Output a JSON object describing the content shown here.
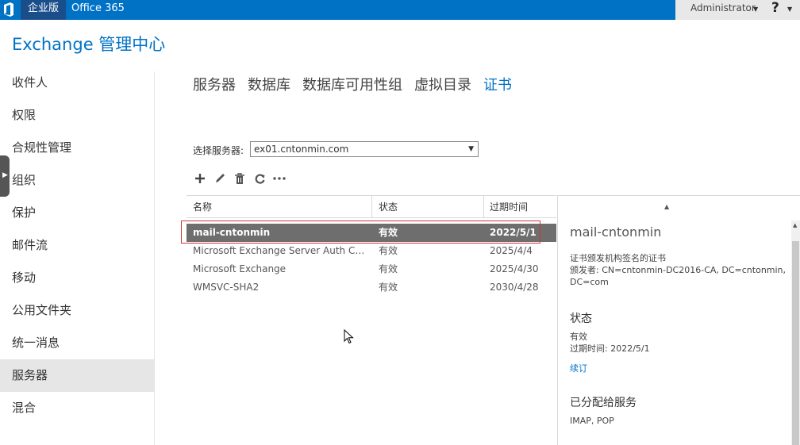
{
  "topbar": {
    "brand": "企业版",
    "office365": "Office 365",
    "user": "Administrator",
    "help": "?"
  },
  "app_title": "Exchange 管理中心",
  "nav": {
    "items": [
      "收件人",
      "权限",
      "合规性管理",
      "组织",
      "保护",
      "邮件流",
      "移动",
      "公用文件夹",
      "统一消息",
      "服务器",
      "混合"
    ],
    "active": "服务器"
  },
  "tabs": {
    "items": [
      "服务器",
      "数据库",
      "数据库可用性组",
      "虚拟目录",
      "证书"
    ],
    "active": "证书"
  },
  "server_select": {
    "label": "选择服务器:",
    "value": "ex01.cntonmin.com"
  },
  "toolbar": {
    "icons": [
      "add-icon",
      "edit-icon",
      "delete-icon",
      "refresh-icon",
      "more-icon"
    ]
  },
  "table": {
    "headers": [
      "名称",
      "状态",
      "过期时间"
    ],
    "rows": [
      [
        "mail-cntonmin",
        "有效",
        "2022/5/1"
      ],
      [
        "Microsoft Exchange Server Auth Certific...",
        "有效",
        "2025/4/4"
      ],
      [
        "Microsoft Exchange",
        "有效",
        "2025/4/30"
      ],
      [
        "WMSVC-SHA2",
        "有效",
        "2030/4/28"
      ]
    ]
  },
  "details": {
    "title": "mail-cntonmin",
    "issuer_heading": "证书颁发机构签名的证书",
    "issuer_line1": "颁发者: CN=cntonmin-DC2016-CA, DC=cntonmin,",
    "issuer_line2": "DC=com",
    "status_heading": "状态",
    "status_value": "有效",
    "expiry": "过期时间: 2022/5/1",
    "renew_link": "续订",
    "services_heading": "已分配给服务",
    "services_value": "IMAP, POP"
  },
  "colors": {
    "accent": "#0072c6",
    "selected_row": "#6e6e6e",
    "highlight_box": "#d2343c"
  }
}
